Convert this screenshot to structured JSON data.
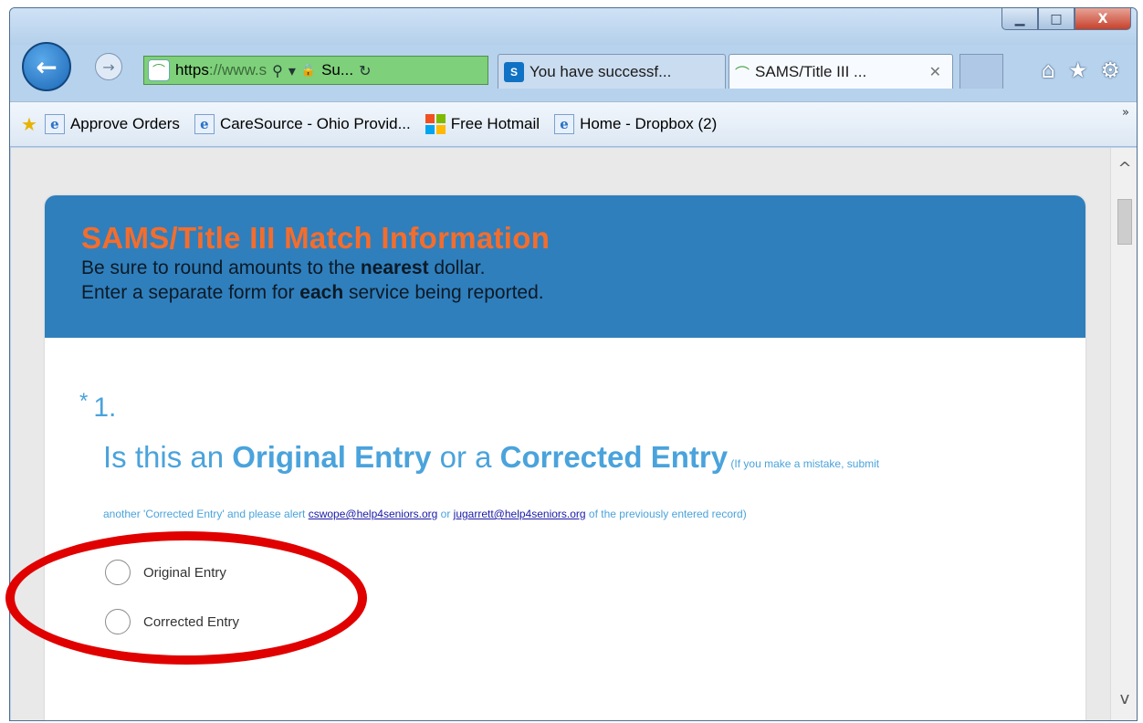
{
  "window": {
    "controls": {
      "minimize": "▁",
      "maximize": "□",
      "close": "X"
    }
  },
  "nav": {
    "back_icon": "←",
    "forward_icon": "→",
    "address": {
      "url_main": "https",
      "url_dim": "://www.s",
      "search_glyph": "⚲",
      "dropdown_glyph": "▾",
      "lock_glyph": "🔒",
      "security_text": "Su...",
      "refresh_glyph": "↻"
    },
    "tabs": [
      {
        "icon": "S",
        "label": "You have successf...",
        "active": false
      },
      {
        "icon": "⌒",
        "label": "SAMS/Title III ...",
        "active": true,
        "close": "✕"
      }
    ],
    "tools": {
      "home": "⌂",
      "favorites": "★",
      "settings": "⚙"
    }
  },
  "favorites_bar": {
    "items": [
      {
        "icon": "ie-icon",
        "label": "Approve Orders"
      },
      {
        "icon": "ie-icon",
        "label": "CareSource - Ohio Provid..."
      },
      {
        "icon": "windows-icon",
        "label": "Free Hotmail"
      },
      {
        "icon": "ie-icon",
        "label": "Home - Dropbox (2)"
      }
    ],
    "overflow": "»"
  },
  "form": {
    "title": "SAMS/Title III Match Information",
    "line1_pre": "Be sure to round amounts to the ",
    "line1_bold": "nearest",
    "line1_post": " dollar.",
    "line2_pre": "Enter a separate form for ",
    "line2_bold": "each",
    "line2_post": " service being reported."
  },
  "question": {
    "required_mark": "*",
    "number": "1.",
    "text_a": "Is this an ",
    "text_b": "Original Entry",
    "text_c": " or a ",
    "text_d": "Corrected Entry",
    "small_note": " (If you make a mistake, submit",
    "note_pre": "another 'Corrected Entry' and please alert ",
    "email1": "cswope@help4seniors.org",
    "note_mid": " or ",
    "email2": "jugarrett@help4seniors.org",
    "note_post": " of the previously entered record)",
    "options": [
      "Original Entry",
      "Corrected Entry"
    ]
  },
  "scrollbar": {
    "up": "^",
    "down": "v"
  },
  "colors": {
    "header_blue": "#2f7fbd",
    "title_orange": "#f46d2c",
    "question_blue": "#4aa3dc",
    "annotation_red": "#e00000",
    "address_green": "#7ed07a"
  }
}
